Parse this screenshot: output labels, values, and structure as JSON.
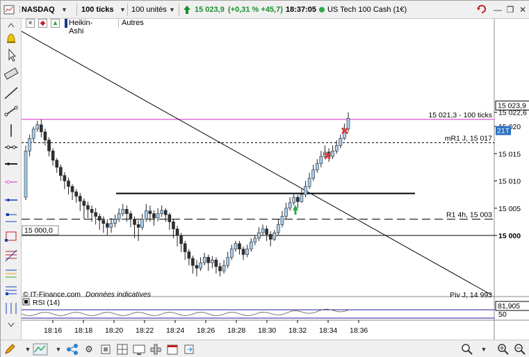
{
  "toolbar": {
    "instrument": "NASDAQ",
    "period": "100 ticks",
    "units": "100 unités",
    "price": "15 023,9",
    "change": "(+0,31 % +45,7)",
    "time": "18:37:05",
    "name": "US Tech 100 Cash (1€)",
    "up_color": "#1a8f2e"
  },
  "subtoolbar": {
    "chart_type": "Heikin-Ashi",
    "others": "Autres"
  },
  "price_axis": {
    "last_price": "15 023,9",
    "countdown": "21T",
    "ticks": [
      "15 022,6",
      "15 020",
      "15 015",
      "15 010",
      "15 005",
      "15 000"
    ],
    "highlight_tick": "15 000"
  },
  "annotations": {
    "ticks_line": "15 021,3 - 100 ticks",
    "mr1": "mR1 J, 15 017",
    "r1": "R1 4h, 15 003",
    "piv": "Piv J, 14 993",
    "level_label": "15 000,0",
    "copyright": "© IT-Finance.com",
    "disclaimer": "Données indicatives"
  },
  "rsi": {
    "title": "RSI (14)",
    "value": "81,905",
    "mid": "50"
  },
  "time_axis": {
    "labels": [
      "18:16",
      "18:18",
      "18:20",
      "18:22",
      "18:24",
      "18:26",
      "18:28",
      "18:30",
      "18:32",
      "18:34",
      "18:36"
    ]
  },
  "colors": {
    "bull": "#a6cdf0",
    "bear": "#303030",
    "magenta": "#e060d8",
    "rsi_band": "#1b1b9a"
  },
  "candles": [
    [
      15007,
      15015.5,
      15006.5,
      15016.5
    ],
    [
      15015.5,
      15017.8,
      15014.5,
      15018.5
    ],
    [
      15017.8,
      15019.5,
      15017,
      15020
    ],
    [
      15019.5,
      15020.3,
      15019,
      15021
    ],
    [
      15020.3,
      15019,
      15018,
      15021.3
    ],
    [
      15019,
      15017.5,
      15016.5,
      15019.6
    ],
    [
      15017.5,
      15015.5,
      15014.5,
      15018
    ],
    [
      15015.5,
      15013.8,
      15012.8,
      15016
    ],
    [
      15013.8,
      15012.5,
      15011.5,
      15014.2
    ],
    [
      15012.5,
      15011,
      15010,
      15013
    ],
    [
      15011,
      15010,
      15008.5,
      15011.6
    ],
    [
      15010,
      15009,
      15007.5,
      15010.6
    ],
    [
      15009,
      15008,
      15006.5,
      15009.4
    ],
    [
      15008,
      15007.2,
      15006,
      15008.5
    ],
    [
      15007.2,
      15006.3,
      15004.5,
      15007.8
    ],
    [
      15006.3,
      15005.5,
      15003,
      15006.8
    ],
    [
      15005.5,
      15004.8,
      15003.2,
      15006.2
    ],
    [
      15004.8,
      15004.2,
      15002.5,
      15005.5
    ],
    [
      15004.2,
      15003.5,
      15002,
      15005
    ],
    [
      15003.5,
      15002.8,
      15001,
      15004
    ],
    [
      15002.8,
      15002.2,
      15000.5,
      15003.5
    ],
    [
      15002.2,
      15001.5,
      15000,
      15003
    ],
    [
      15001.5,
      15002.2,
      15000.5,
      15003.2
    ],
    [
      15002.2,
      15003,
      15001.5,
      15003.8
    ],
    [
      15003,
      15004,
      15002.5,
      15005
    ],
    [
      15004,
      15004.8,
      15003.5,
      15005.8
    ],
    [
      15004.8,
      15004,
      15002.5,
      15005.5
    ],
    [
      15004,
      15003,
      15001.5,
      15004.5
    ],
    [
      15003,
      15002,
      14999.5,
      15003.5
    ],
    [
      15002,
      15001.5,
      14999,
      15002.8
    ],
    [
      15001.5,
      15003,
      15001,
      15004
    ],
    [
      15003,
      15004.5,
      15002.5,
      15005.8
    ],
    [
      15004.5,
      15004,
      15002.5,
      15005.5
    ],
    [
      15004,
      15003.2,
      15001.8,
      15004.6
    ],
    [
      15003.2,
      15004,
      15002.6,
      15005
    ],
    [
      15004,
      15004.6,
      15003.4,
      15005.5
    ],
    [
      15004.6,
      15003.8,
      15002.5,
      15005
    ],
    [
      15003.8,
      15002.5,
      15001,
      15004.2
    ],
    [
      15002.5,
      15001.2,
      14999.5,
      15003
    ],
    [
      15001.2,
      15000,
      14998,
      15001.8
    ],
    [
      15000,
      14998.5,
      14997,
      15000.5
    ],
    [
      14998.5,
      14997,
      14995.5,
      14999
    ],
    [
      14997,
      14995.8,
      14994.5,
      14997.5
    ],
    [
      14995.8,
      14994.5,
      14993,
      14996.3
    ],
    [
      14994.5,
      14994,
      14992.5,
      14995.5
    ],
    [
      14994,
      14995,
      14993.5,
      14996
    ],
    [
      14995,
      14996,
      14994.5,
      14996.8
    ],
    [
      14996,
      14995,
      14993.5,
      14996.5
    ],
    [
      14995,
      14995.5,
      14994,
      14996.2
    ],
    [
      14995.5,
      14994.3,
      14993,
      14996
    ],
    [
      14994.3,
      14993.5,
      14992.5,
      14995
    ],
    [
      14993.5,
      14994.5,
      14993,
      14995.5
    ],
    [
      14994.5,
      14996,
      14994,
      14997
    ],
    [
      14996,
      14997.5,
      14995.5,
      14998.3
    ],
    [
      14997.5,
      14998.5,
      14997,
      14999
    ],
    [
      14998.5,
      14997.5,
      14996.5,
      14999
    ],
    [
      14997.5,
      14996.5,
      14995.5,
      14998
    ],
    [
      14996.5,
      14997.5,
      14996,
      14998.3
    ],
    [
      14997.5,
      14998.8,
      14997,
      14999.5
    ],
    [
      14998.8,
      14999.5,
      14998.2,
      15000
    ],
    [
      14999.5,
      15000.5,
      14999,
      15001.5
    ],
    [
      15000.5,
      15001.2,
      15000,
      15002
    ],
    [
      15001.2,
      15000.2,
      14999,
      15001.8
    ],
    [
      15000.2,
      14999.3,
      14998,
      15000.8
    ],
    [
      14999.3,
      15000.5,
      14999,
      15001
    ],
    [
      15000.5,
      15002,
      15000,
      15003
    ],
    [
      15002,
      15003.5,
      15001.5,
      15004.5
    ],
    [
      15003.5,
      15005,
      15003,
      15006
    ],
    [
      15005,
      15006,
      15004.5,
      15007
    ],
    [
      15006,
      15007,
      15005.5,
      15007.8
    ],
    [
      15007,
      15006.2,
      15005,
      15007.5
    ],
    [
      15006.2,
      15007.5,
      15006,
      15008.5
    ],
    [
      15007.5,
      15009,
      15007,
      15010
    ],
    [
      15009,
      15010.5,
      15008.5,
      15011.5
    ],
    [
      15010.5,
      15012,
      15010,
      15013
    ],
    [
      15012,
      15013.2,
      15011.5,
      15014
    ],
    [
      15013.2,
      15014.5,
      15012.5,
      15015.5
    ],
    [
      15014.5,
      15015.3,
      15014,
      15016.5
    ],
    [
      15015.3,
      15014.5,
      15013.5,
      15016
    ],
    [
      15014.5,
      15015.5,
      15014,
      15016.5
    ],
    [
      15015.5,
      15016.5,
      15015,
      15017.5
    ],
    [
      15016.5,
      15017.8,
      15016,
      15018.5
    ],
    [
      15017.8,
      15019.5,
      15017.5,
      15020.5
    ],
    [
      15019.5,
      15021.5,
      15019,
      15022.6
    ]
  ]
}
